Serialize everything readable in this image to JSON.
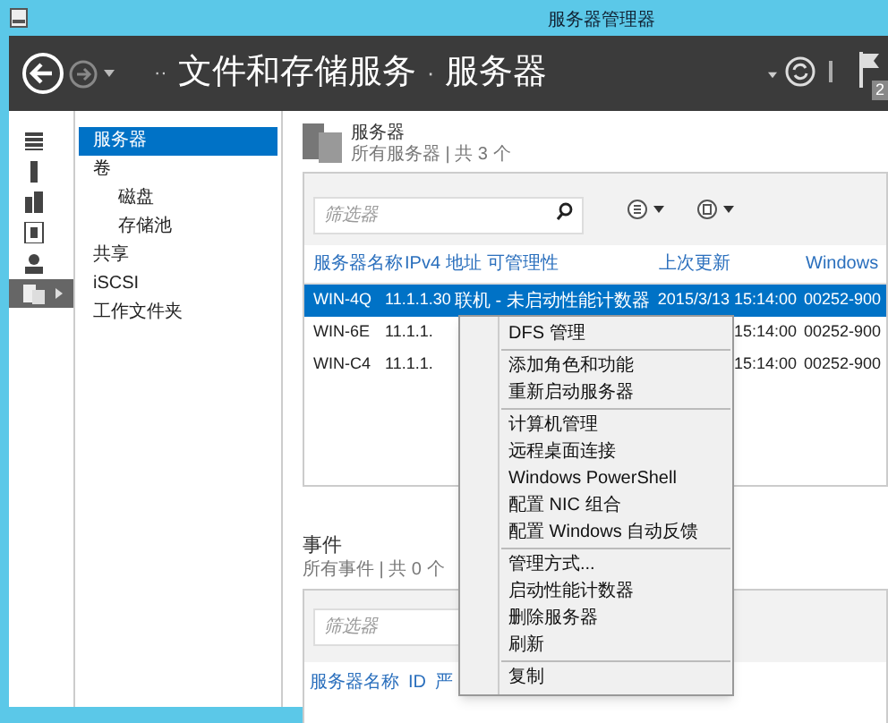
{
  "window": {
    "title": "服务器管理器"
  },
  "breadcrumb": {
    "separator_lead": "··",
    "parts": [
      "文件和存储服务",
      "服务器"
    ],
    "separator": "·"
  },
  "header_tools": {
    "flag_badge": "2"
  },
  "icon_rail": [
    {
      "selected": false
    },
    {
      "selected": false
    },
    {
      "selected": false
    },
    {
      "selected": false
    },
    {
      "selected": false
    },
    {
      "selected": true
    }
  ],
  "nav": [
    {
      "label": "服务器",
      "selected": true
    },
    {
      "label": "卷",
      "selected": false,
      "children": [
        {
          "label": "磁盘",
          "selected": false
        },
        {
          "label": "存储池",
          "selected": false
        }
      ]
    },
    {
      "label": "共享",
      "selected": false
    },
    {
      "label": "iSCSI",
      "selected": false
    },
    {
      "label": "工作文件夹",
      "selected": false
    }
  ],
  "servers": {
    "title": "服务器",
    "subtitle": "所有服务器 | 共 3 个",
    "filter": {
      "placeholder": "筛选器"
    },
    "columns": [
      "服务器名称",
      "IPv4 地址",
      "可管理性",
      "上次更新",
      "Windows"
    ],
    "rows": [
      {
        "selected": true,
        "cells": [
          "WIN-4Q",
          "11.1.1.30",
          "联机 - 未启动性能计数器",
          "2015/3/13 15:14:00",
          "00252-900"
        ]
      },
      {
        "selected": false,
        "cells": [
          "WIN-6E",
          "11.1.1.",
          "",
          "15:14:00",
          "00252-900"
        ]
      },
      {
        "selected": false,
        "cells": [
          "WIN-C4",
          "11.1.1.",
          "",
          "15:14:00",
          "00252-900"
        ]
      }
    ]
  },
  "events": {
    "title": "事件",
    "subtitle": "所有事件 | 共 0 个",
    "filter": {
      "placeholder": "筛选器"
    },
    "columns": [
      "服务器名称",
      "ID",
      "严"
    ]
  },
  "context_menu": [
    {
      "label": "DFS 管理",
      "separator_after": true
    },
    {
      "label": "添加角色和功能",
      "separator_after": false
    },
    {
      "label": "重新启动服务器",
      "separator_after": true
    },
    {
      "label": "计算机管理",
      "separator_after": false
    },
    {
      "label": "远程桌面连接",
      "separator_after": false
    },
    {
      "label": "Windows PowerShell",
      "separator_after": false
    },
    {
      "label": "配置 NIC 组合",
      "separator_after": false
    },
    {
      "label": "配置 Windows 自动反馈",
      "separator_after": true
    },
    {
      "label": "管理方式...",
      "separator_after": false
    },
    {
      "label": "启动性能计数器",
      "separator_after": false
    },
    {
      "label": "删除服务器",
      "separator_after": false
    },
    {
      "label": "刷新",
      "separator_after": true
    },
    {
      "label": "复制",
      "separator_after": false
    }
  ]
}
